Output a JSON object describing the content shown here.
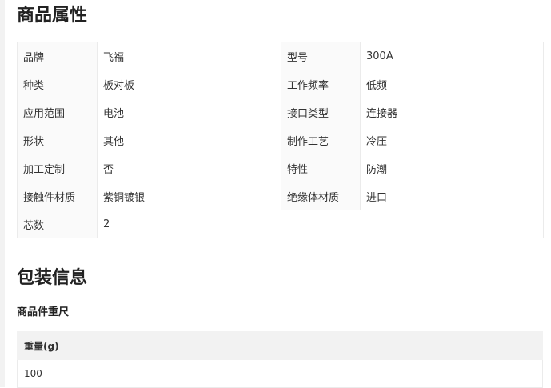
{
  "sections": {
    "attributes_title": "商品属性",
    "packaging_title": "包装信息"
  },
  "attributes": {
    "rows": [
      [
        {
          "k": "品牌",
          "v": "飞福"
        },
        {
          "k": "型号",
          "v": "300A"
        }
      ],
      [
        {
          "k": "种类",
          "v": "板对板"
        },
        {
          "k": "工作频率",
          "v": "低频"
        }
      ],
      [
        {
          "k": "应用范围",
          "v": "电池"
        },
        {
          "k": "接口类型",
          "v": "连接器"
        }
      ],
      [
        {
          "k": "形状",
          "v": "其他"
        },
        {
          "k": "制作工艺",
          "v": "冷压"
        }
      ],
      [
        {
          "k": "加工定制",
          "v": "否"
        },
        {
          "k": "特性",
          "v": "防潮"
        }
      ],
      [
        {
          "k": "接触件材质",
          "v": "紫铜镀银"
        },
        {
          "k": "绝缘体材质",
          "v": "进口"
        }
      ],
      [
        {
          "k": "芯数",
          "v": "2"
        }
      ]
    ]
  },
  "packaging": {
    "subtitle": "商品件重尺",
    "weight_header": "重量(g)",
    "weight_value": "100"
  }
}
